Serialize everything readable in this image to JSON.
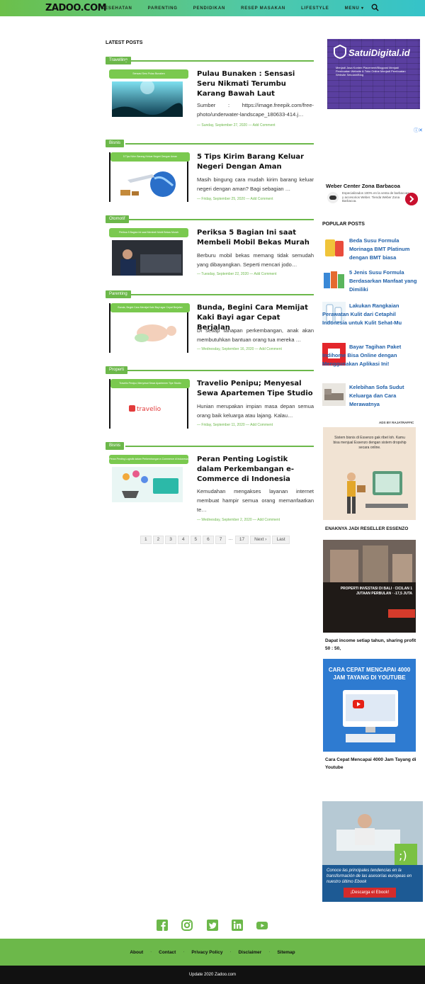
{
  "header": {
    "logo": "ZADOO.COM",
    "nav": [
      "KESEHATAN",
      "PARENTING",
      "PENDIDIKAN",
      "RESEP MASAKAN",
      "LIFESTYLE",
      "MENU ▾"
    ],
    "icons": {
      "search": "search-icon"
    }
  },
  "main": {
    "section_title": "LATEST POSTS",
    "posts": [
      {
        "category": "Travelling",
        "thumb_banner": "Sensasi Seru Pulau Bunaken",
        "title": "Pulau Bunaken : Sensasi Seru Nikmati Terumbu Karang Bawah Laut",
        "excerpt": "Sumber : https://image.freepik.com/free-photo/underwater-landscape_180633-414.j…",
        "meta": "— Sunday, September 27, 2020 — Add Comment"
      },
      {
        "category": "Bisnis",
        "thumb_banner": "5 Tips Kirim Barang Keluar Negeri Dengan Aman",
        "title": "5 Tips Kirim Barang Keluar Negeri Dengan Aman",
        "excerpt": "Masih bingung cara mudah kirim barang keluar negeri dengan aman? Bagi sebagian …",
        "meta": "— Friday, September 25, 2020 — Add Comment"
      },
      {
        "category": "Otomotif",
        "thumb_banner": "Periksa 5 Bagian Ini saat Membeli Mobil Bekas Murah",
        "title": "Periksa 5 Bagian Ini saat Membeli Mobil Bekas Murah",
        "excerpt": "Berburu mobil bekas memang tidak semudah yang dibayangkan. Seperti mencari jodo…",
        "meta": "— Tuesday, September 22, 2020 — Add Comment"
      },
      {
        "category": "Parenting",
        "thumb_banner": "Bunda, Begini Cara Memijat Kaki Bayi agar Cepat Berjalan",
        "title": "Bunda, Begini Cara Memijat Kaki Bayi agar Cepat Berjalan",
        "excerpt": "Di setiap tahapan perkembangan, anak akan membutuhkan bantuan orang tua mereka …",
        "meta": "— Wednesday, September 16, 2020 — Add Comment"
      },
      {
        "category": "Properti",
        "thumb_banner": "Travelio Penipu; Menyesal Sewa Apartemen Tipe Studio",
        "title": "Travelio Penipu; Menyesal Sewa Apartemen Tipe Studio",
        "excerpt": "Hunian merupakan impian masa depan semua orang baik keluarga atau lajang. Kalau…",
        "meta": "— Friday, September 11, 2020 — Add Comment"
      },
      {
        "category": "Bisnis",
        "thumb_banner": "Peran Penting Logistik dalam Perkembangan e-Commerce di Indonesia",
        "title": "Peran Penting Logistik dalam Perkembangan e-Commerce di Indonesia",
        "excerpt": "Kemudahan mengakses layanan internet membuat hampir semua orang memanfaatkan te…",
        "meta": "— Wednesday, September 2, 2020 — Add Comment"
      }
    ],
    "pager": [
      "1",
      "2",
      "3",
      "4",
      "5",
      "6",
      "7",
      "…",
      "17",
      "Next ›",
      "Last"
    ]
  },
  "sidebar": {
    "ad1": {
      "name": "SatuiDigital.id",
      "sub": "Menjadi Jasa Konten Placement/Blogpost Menjadi Pembuatan Website & Toko Online Menjadi Pembuatan Website Sekolah/Blog"
    },
    "ad2": {
      "title": "Weber Center Zona Barbacoa",
      "sub": "Especializados 100% en la venta de barbacoas y accesorios Weber. Tienda Weber Zona Barbacoa."
    },
    "popular_title": "POPULAR POSTS",
    "popular": [
      "Beda Susu Formula Morinaga BMT Platinum dengan BMT biasa",
      "5 Jenis Susu Formula Berdasarkan Manfaat yang Dimiliki",
      "Lakukan Rangkaian Perawatan Kulit dari Cetaphil Indonesia untuk Kulit Sehat-Mu",
      "Bayar Tagihan Paket Indihome Bisa Online dengan Menggunakan Aplikasi Ini!",
      "Kelebihan Sofa Sudut Keluarga dan Cara Merawatnya"
    ],
    "ads_by": "ADS BY RAJATRAFFIC",
    "ad3": {
      "img_text": "Sistem bisnis di Essenzo gak ribet loh. Kamu bisa menjual Essenzo dengan sistem dropship secara online.",
      "caption": "ENAKNYA JADI RESELLER ESSENZO"
    },
    "ad4": {
      "img_text": "PROPERTI INVESTASI DI BALI · CICILAN 1 JUTAAN PERBULAN · -17,5 JUTA",
      "caption": "Dapat income setiap tahun, sharing profit 50 : 50,"
    },
    "ad5": {
      "img_text": "CARA CEPAT MENCAPAI 4000 JAM TAYANG DI YOUTUBE",
      "caption": "Cara Cepat Mencapai 4000 Jam Tayang di Youtube"
    },
    "ad6": {
      "text": "Conoce las principales tendencias en la transformación de las asesorías europeas en nuestro último Ebook",
      "button": "¡Descarga el Ebook!"
    }
  },
  "social": [
    "facebook-icon",
    "instagram-icon",
    "twitter-icon",
    "linkedin-icon",
    "youtube-icon"
  ],
  "footer": {
    "links": [
      "About",
      "Contact",
      "Privacy Policy",
      "Disclaimer",
      "Sitemap"
    ],
    "copyright": "Update 2020 Zadoo.com"
  },
  "colors": {
    "accent": "#6cb84a",
    "header_gradient_end": "#35c3c9",
    "link": "#1f5fa8"
  }
}
